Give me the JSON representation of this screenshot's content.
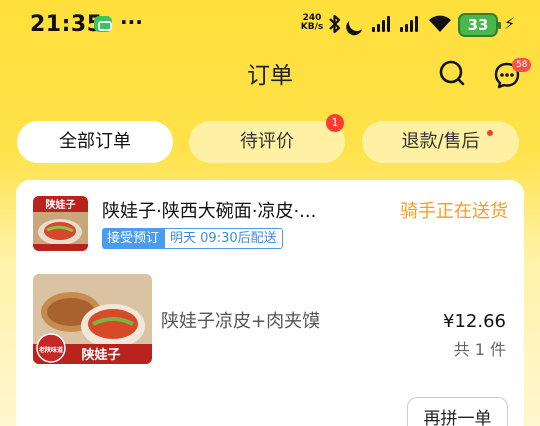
{
  "status_bar": {
    "time": "21:35",
    "net_speed_value": "240",
    "net_speed_unit": "KB/s",
    "battery": "33",
    "icons": [
      "message-icon",
      "more-icon",
      "bluetooth-icon",
      "moon-icon",
      "signal-icon",
      "wifi-icon",
      "battery-icon",
      "charging-icon"
    ]
  },
  "header": {
    "title": "订单",
    "chat_badge": "58"
  },
  "tabs": [
    {
      "label": "全部订单",
      "active": true
    },
    {
      "label": "待评价",
      "badge": "1"
    },
    {
      "label": "退款/售后",
      "dot": true
    }
  ],
  "order": {
    "shop_name": "陕娃子·陕西大碗面·凉皮·...",
    "status": "骑手正在送货",
    "tag_preorder": "接受预订",
    "tag_time": "明天 09:30后配送",
    "item": {
      "name": "陕娃子凉皮+肉夹馍",
      "price": "¥12.66",
      "quantity": "共 1 件"
    },
    "reorder_label": "再拼一单",
    "shop_logo_text": "陕娃子",
    "item_img_text": "陕娃子",
    "item_img_badge": "老陕味道"
  },
  "colors": {
    "accent_yellow": "#ffdf3a",
    "status_orange": "#ff9a1b",
    "tag_blue": "#4a9cf0",
    "badge_red": "#ff3b30"
  }
}
